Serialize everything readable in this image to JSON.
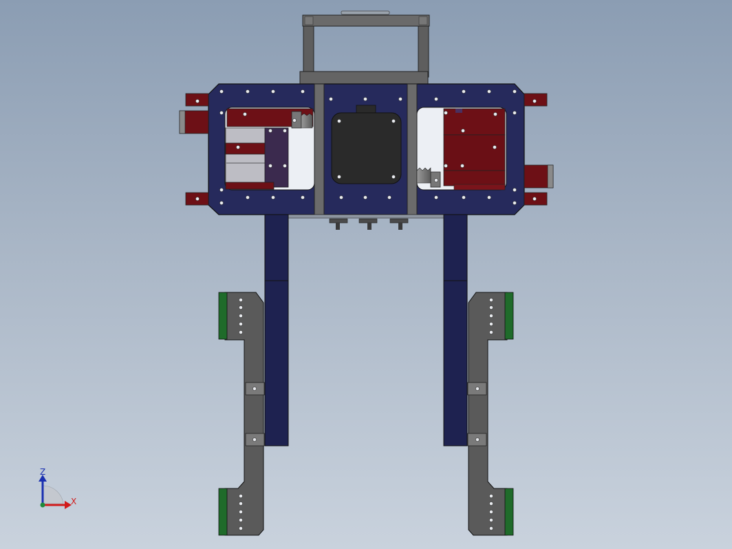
{
  "axes": {
    "z_label": "Z",
    "x_label": "X",
    "z_color": "#1a2fb0",
    "x_color": "#d11a1a"
  },
  "colors": {
    "frame_navy": "#262a5c",
    "frame_navy_dark": "#1e2250",
    "slider_red": "#6d1016",
    "gray_metal": "#5a5a5a",
    "dark_motor": "#2a2a2a",
    "pad_green": "#1f6b2a",
    "window_light": "#eceff4"
  },
  "icons": [
    "triad-icon"
  ]
}
